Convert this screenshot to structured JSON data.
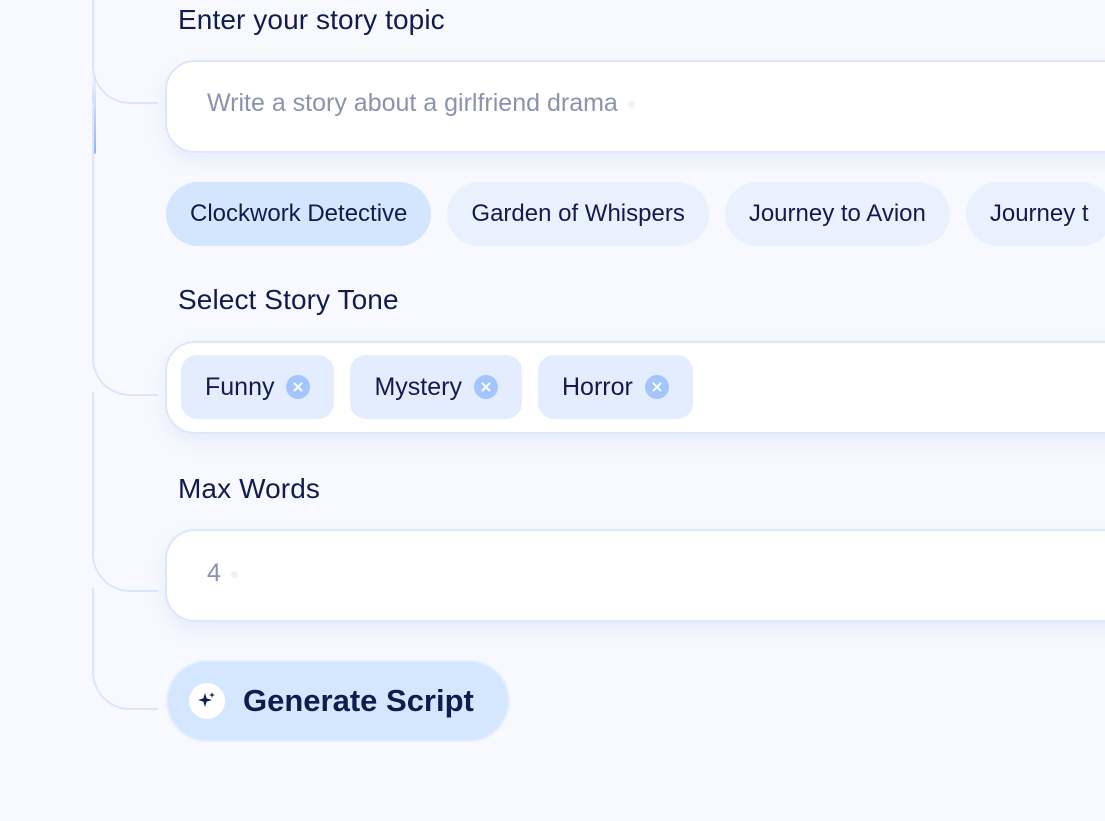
{
  "topic": {
    "label": "Enter your story topic",
    "placeholder": "Write a story about a girlfriend drama"
  },
  "suggestions": [
    {
      "label": "Clockwork Detective",
      "selected": true
    },
    {
      "label": "Garden of Whispers",
      "selected": false
    },
    {
      "label": "Journey to Avion",
      "selected": false
    },
    {
      "label": "Journey t",
      "selected": false
    }
  ],
  "tone": {
    "label": "Select Story Tone",
    "selected": [
      "Funny",
      "Mystery",
      "Horror"
    ]
  },
  "max_words": {
    "label": "Max Words",
    "placeholder": "4"
  },
  "generate_button": {
    "label": "Generate Script",
    "icon": "sparkle-icon"
  },
  "colors": {
    "background": "#f7f9fe",
    "chip": "#e9f1ff",
    "chip_selected": "#d4e5fe",
    "tag": "#e3edfe",
    "tag_remove": "#a3c5fb",
    "button": "#d5e6ff",
    "text": "#0f1c4d",
    "placeholder": "#8a93ad",
    "connector": "#dbe6fb"
  }
}
